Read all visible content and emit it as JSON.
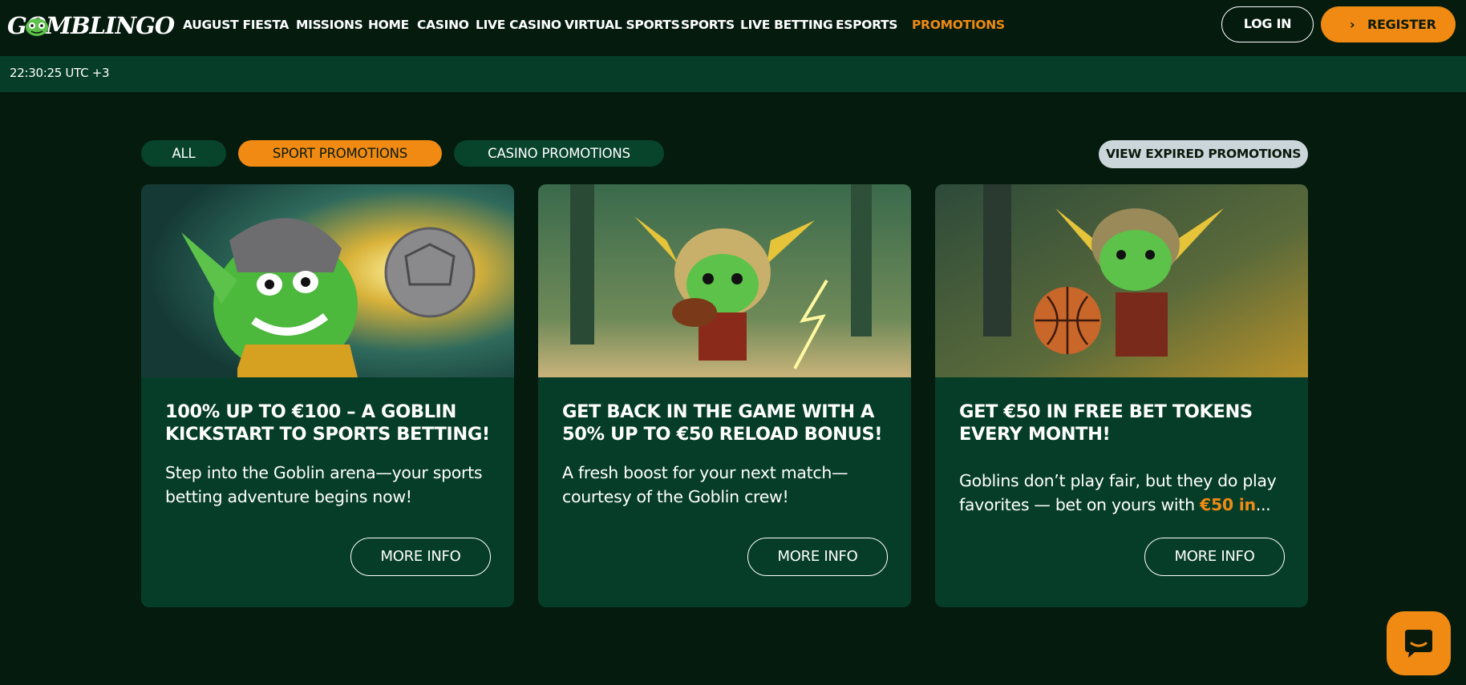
{
  "header": {
    "logo_text": "GOMBLINGO",
    "nav": [
      {
        "label": "AUGUST FIESTA",
        "active": false
      },
      {
        "label": "MISSIONS",
        "active": false
      },
      {
        "label": "HOME",
        "active": false
      },
      {
        "label": "CASINO",
        "active": false
      },
      {
        "label": "LIVE CASINO",
        "active": false
      },
      {
        "label": "VIRTUAL SPORTS",
        "active": false
      },
      {
        "label": "SPORTS",
        "active": false
      },
      {
        "label": "LIVE BETTING",
        "active": false
      },
      {
        "label": "ESPORTS",
        "active": false
      },
      {
        "label": "PROMOTIONS",
        "active": true
      }
    ],
    "login_label": "LOG IN",
    "register_label": "REGISTER",
    "register_icon": "chevron-right-icon"
  },
  "timebar": {
    "time": "22:30:25 UTC +3"
  },
  "filters": {
    "all": "ALL",
    "sport": "SPORT PROMOTIONS",
    "casino": "CASINO PROMOTIONS",
    "selected": "SPORT PROMOTIONS",
    "expired": "VIEW EXPIRED PROMOTIONS"
  },
  "cards": [
    {
      "title": "100% UP TO €100 – A GOBLIN KICKSTART TO SPORTS BETTING!",
      "desc": "Step into the Goblin arena—your sports betting adventure begins now!",
      "button": "MORE INFO",
      "image": "goblin-with-soccer-ball"
    },
    {
      "title": "GET BACK IN THE GAME WITH A 50% UP TO €50 RELOAD BONUS!",
      "desc": "A fresh boost for your next match—courtesy of the Goblin crew!",
      "button": "MORE INFO",
      "image": "goblin-with-football"
    },
    {
      "title": "GET €50 IN FREE BET TOKENS EVERY MONTH!",
      "desc": "Goblins don’t play fair, but they do play favorites — bet on yours with ",
      "desc_highlight": "€50 in",
      "desc_tail": "...",
      "button": "MORE INFO",
      "image": "goblin-with-basketball"
    }
  ],
  "colors": {
    "background": "#041b0e",
    "card": "#063d29",
    "accent": "#f08a12"
  },
  "chat": {
    "icon": "chat-bubble-icon"
  }
}
